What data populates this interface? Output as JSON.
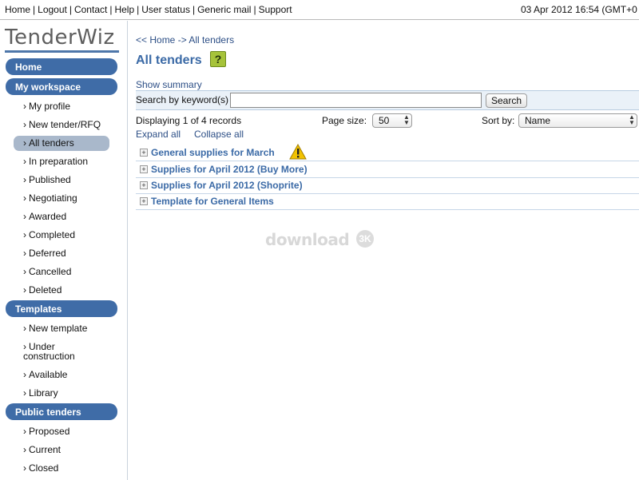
{
  "topnav": {
    "links": [
      "Home",
      "Logout",
      "Contact",
      "Help",
      "User status",
      "Generic mail",
      "Support"
    ],
    "datetime": "03 Apr 2012 16:54 (GMT+0"
  },
  "sidebar": {
    "logo": "TenderWiz",
    "home": "Home",
    "workspace": {
      "title": "My workspace",
      "items": [
        "My profile",
        "New tender/RFQ",
        "All tenders",
        "In preparation",
        "Published",
        "Negotiating",
        "Awarded",
        "Completed",
        "Deferred",
        "Cancelled",
        "Deleted"
      ],
      "selected": "All tenders"
    },
    "templates": {
      "title": "Templates",
      "items": [
        "New template",
        "Under construction",
        "Available",
        "Library"
      ]
    },
    "public": {
      "title": "Public tenders",
      "items": [
        "Proposed",
        "Current",
        "Closed"
      ]
    },
    "chevron": "›"
  },
  "main": {
    "breadcrumb": {
      "home": "<< Home",
      "arrow": "->",
      "current": "All tenders"
    },
    "title": "All tenders",
    "help_icon": "?",
    "show_summary": "Show summary",
    "search": {
      "label": "Search by keyword(s)",
      "value": "",
      "button": "Search"
    },
    "displaying": "Displaying 1 of 4 records",
    "page_size": {
      "label": "Page size:",
      "value": "50"
    },
    "sort_by": {
      "label": "Sort by:",
      "value": "Name"
    },
    "expand_all": "Expand all",
    "collapse_all": "Collapse all",
    "tenders": [
      {
        "name": "General supplies for March",
        "warning": true
      },
      {
        "name": "Supplies for April 2012 (Buy More)",
        "warning": false
      },
      {
        "name": "Supplies for April 2012 (Shoprite)",
        "warning": false
      },
      {
        "name": "Template for General Items",
        "warning": false
      }
    ],
    "watermark": "download",
    "watermark_badge": "3K"
  },
  "colors": {
    "accent": "#3f6ca7",
    "selected": "#a9b8cb",
    "link": "#2d4f86",
    "help": "#a6c33a",
    "warning": "#f2c200"
  }
}
